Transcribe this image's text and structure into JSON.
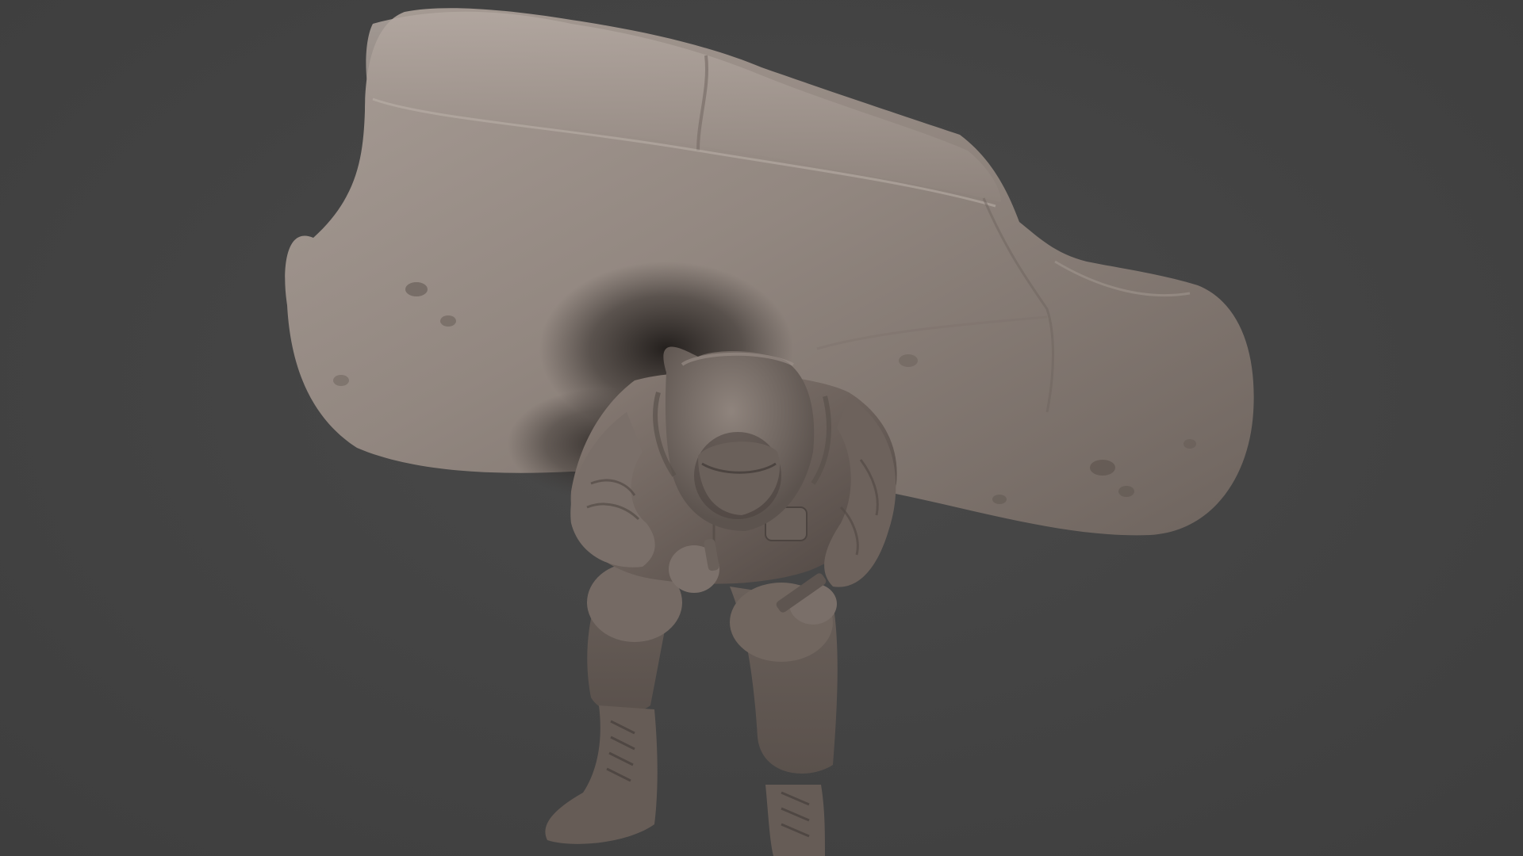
{
  "viewport": {
    "background_color": "#434343",
    "model_color": "#8a7d75",
    "objects": [
      {
        "name": "rock",
        "description_icon": "rock-sculpt"
      },
      {
        "name": "figure",
        "description_icon": "hooded-soldier-sculpt"
      }
    ]
  }
}
